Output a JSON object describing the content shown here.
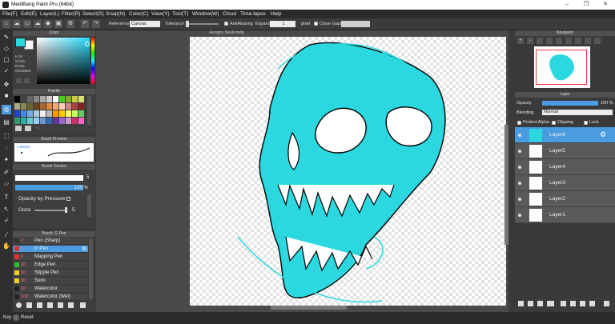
{
  "window": {
    "title": "MediBang Paint Pro (64bit)",
    "min": "–",
    "max": "❐",
    "close": "✕"
  },
  "menu": [
    "File(F)",
    "Edit(E)",
    "Layer(L)",
    "Filter(R)",
    "Select(S)",
    "Snap(N)",
    "Color(C)",
    "View(Y)",
    "Tool(T)",
    "Window(W)",
    "Cloud",
    "Time-lapse",
    "Help"
  ],
  "toolbar": {
    "reference_label": "Reference",
    "reference_value": "Canvas",
    "tolerance_label": "Tolerance",
    "antialiasing_label": "AntiAliasing",
    "expand_label": "Expand",
    "expand_value": "1",
    "expand_unit": "pixel",
    "close_gaps_label": "Close Gaps"
  },
  "document_tab": "Hungry Skull.mdp",
  "color_panel": {
    "title": "Color",
    "h": "H:44",
    "s": "S:216",
    "b": "B:216",
    "hex": "#2CD8E0",
    "fg": "#2cd8e0",
    "bg": "#ffffff"
  },
  "palette_panel": {
    "title": "Palette"
  },
  "brush_preview": {
    "title": "Brush Preview",
    "size": "1.88mm"
  },
  "brush_control": {
    "title": "Brush Control",
    "size_value": "5",
    "opacity_value": "100 %",
    "opacity_pressure": "Opacity by Pressure",
    "ooze_label": "Ooze",
    "ooze_value": "5"
  },
  "brush_list": {
    "title": "Brush: G Pen",
    "items": [
      {
        "num": "2",
        "name": "Pen (Sharp)",
        "color": "#333333"
      },
      {
        "num": "5",
        "name": "G Pen",
        "color": "#e03030"
      },
      {
        "num": "8",
        "name": "Mapping Pen",
        "color": "#e03030"
      },
      {
        "num": "20",
        "name": "Edge Pen",
        "color": "#2ec02e"
      },
      {
        "num": "50",
        "name": "Stipple Pen",
        "color": "#f0d020"
      },
      {
        "num": "30",
        "name": "Sumi",
        "color": "#f0d020"
      },
      {
        "num": "10",
        "name": "Watercolor",
        "color": "#222222"
      },
      {
        "num": "100",
        "name": "Watercolor (Wet)",
        "color": "#222222"
      }
    ]
  },
  "navigator": {
    "title": "Navigator"
  },
  "layer_panel": {
    "title": "Layer",
    "opacity_label": "Opacity",
    "opacity_value": "100 %",
    "blending_label": "Blending",
    "blending_value": "Normal",
    "protect_alpha": "Protect Alpha",
    "clipping": "Clipping",
    "lock": "Lock",
    "layers": [
      "Layer6",
      "Layer5",
      "Layer4",
      "Layer3",
      "Layer2",
      "Layer1"
    ]
  },
  "status": {
    "key": "Key",
    "reset": "Reset"
  },
  "colors": {
    "accent": "#4a9be0",
    "skull": "#2cd8e0"
  }
}
